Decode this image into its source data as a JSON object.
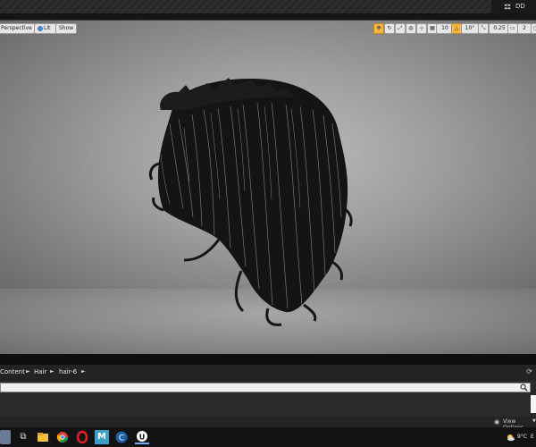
{
  "window": {
    "right_label": "DD"
  },
  "viewport": {
    "perspective_label": "Perspective",
    "lit_label": "Lit",
    "show_label": "Show",
    "grid_snap_value": "10",
    "rotation_snap_value": "10°",
    "scale_snap_value": "0.25",
    "camera_speed_value": "2"
  },
  "content_browser": {
    "breadcrumbs": [
      "Content",
      "Hair",
      "hair-6"
    ],
    "search_placeholder": "",
    "view_options_label": "View Options"
  },
  "taskbar": {
    "weather": "9°C",
    "tray_letter": "E"
  }
}
